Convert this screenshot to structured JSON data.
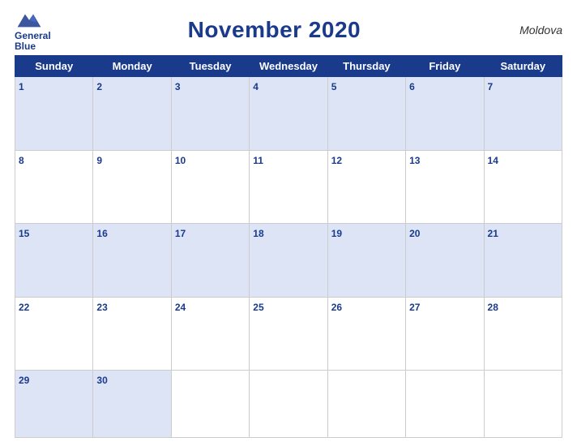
{
  "header": {
    "title": "November 2020",
    "country": "Moldova",
    "logo_line1": "General",
    "logo_line2": "Blue"
  },
  "days_of_week": [
    "Sunday",
    "Monday",
    "Tuesday",
    "Wednesday",
    "Thursday",
    "Friday",
    "Saturday"
  ],
  "weeks": [
    [
      {
        "num": "1",
        "empty": false
      },
      {
        "num": "2",
        "empty": false
      },
      {
        "num": "3",
        "empty": false
      },
      {
        "num": "4",
        "empty": false
      },
      {
        "num": "5",
        "empty": false
      },
      {
        "num": "6",
        "empty": false
      },
      {
        "num": "7",
        "empty": false
      }
    ],
    [
      {
        "num": "8",
        "empty": false
      },
      {
        "num": "9",
        "empty": false
      },
      {
        "num": "10",
        "empty": false
      },
      {
        "num": "11",
        "empty": false
      },
      {
        "num": "12",
        "empty": false
      },
      {
        "num": "13",
        "empty": false
      },
      {
        "num": "14",
        "empty": false
      }
    ],
    [
      {
        "num": "15",
        "empty": false
      },
      {
        "num": "16",
        "empty": false
      },
      {
        "num": "17",
        "empty": false
      },
      {
        "num": "18",
        "empty": false
      },
      {
        "num": "19",
        "empty": false
      },
      {
        "num": "20",
        "empty": false
      },
      {
        "num": "21",
        "empty": false
      }
    ],
    [
      {
        "num": "22",
        "empty": false
      },
      {
        "num": "23",
        "empty": false
      },
      {
        "num": "24",
        "empty": false
      },
      {
        "num": "25",
        "empty": false
      },
      {
        "num": "26",
        "empty": false
      },
      {
        "num": "27",
        "empty": false
      },
      {
        "num": "28",
        "empty": false
      }
    ],
    [
      {
        "num": "29",
        "empty": false
      },
      {
        "num": "30",
        "empty": false
      },
      {
        "num": "",
        "empty": true
      },
      {
        "num": "",
        "empty": true
      },
      {
        "num": "",
        "empty": true
      },
      {
        "num": "",
        "empty": true
      },
      {
        "num": "",
        "empty": true
      }
    ]
  ],
  "colors": {
    "header_bg": "#1a3a8c",
    "row_odd": "#dce4f5",
    "row_even": "#ffffff",
    "day_num": "#1a3a8c"
  }
}
